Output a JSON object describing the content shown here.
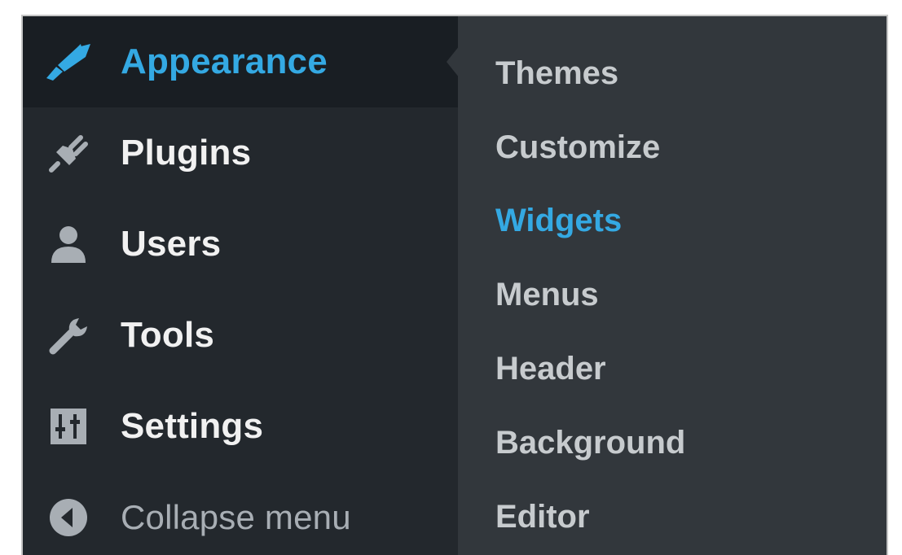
{
  "sidebar": {
    "items": [
      {
        "label": "Appearance",
        "icon": "paintbrush-icon",
        "active": true
      },
      {
        "label": "Plugins",
        "icon": "plug-icon"
      },
      {
        "label": "Users",
        "icon": "user-icon"
      },
      {
        "label": "Tools",
        "icon": "wrench-icon"
      },
      {
        "label": "Settings",
        "icon": "sliders-icon"
      }
    ],
    "collapse": {
      "label": "Collapse menu",
      "icon": "collapse-arrow-icon"
    }
  },
  "submenu": {
    "items": [
      {
        "label": "Themes"
      },
      {
        "label": "Customize"
      },
      {
        "label": "Widgets",
        "current": true
      },
      {
        "label": "Menus"
      },
      {
        "label": "Header"
      },
      {
        "label": "Background"
      },
      {
        "label": "Editor"
      }
    ]
  },
  "colors": {
    "sidebar_bg": "#23282d",
    "active_bg": "#191e23",
    "submenu_bg": "#32373c",
    "accent": "#34a9e3",
    "text": "#f1f1f1",
    "muted_text": "#a8aeb4"
  }
}
